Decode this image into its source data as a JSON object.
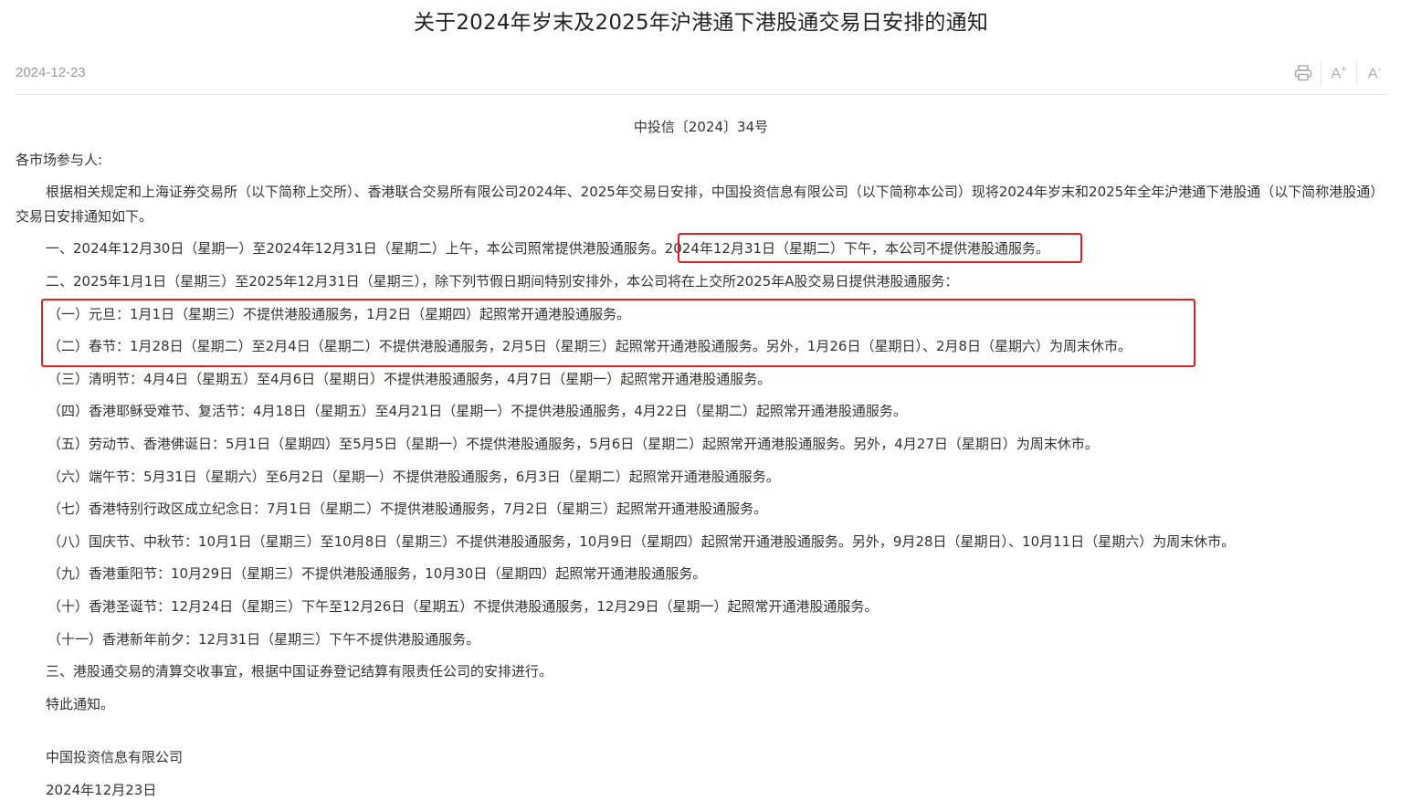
{
  "article": {
    "title": "关于2024年岁末及2025年沪港通下港股通交易日安排的通知",
    "publish_date": "2024-12-23"
  },
  "toolbar": {
    "print_icon": "print-icon",
    "font_increase_label": "A",
    "font_increase_sign": "+",
    "font_decrease_label": "A",
    "font_decrease_sign": "-"
  },
  "body": {
    "doc_number": "中投信〔2024〕34号",
    "salutation": "各市场参与人:",
    "intro": "根据相关规定和上海证券交易所（以下简称上交所）、香港联合交易所有限公司2024年、2025年交易日安排，中国投资信息有限公司（以下简称本公司）现将2024年岁末和2025年全年沪港通下港股通（以下简称港股通）交易日安排通知如下。",
    "item1_part1": "一、2024年12月30日（星期一）至2024年12月31日（星期二）上午，本公司照常提供港股通服务。",
    "item1_part2": "2024年12月31日（星期二）下午，本公司不提供港股通服务。",
    "item2": "二、2025年1月1日（星期三）至2025年12月31日（星期三），除下列节假日期间特别安排外，本公司将在上交所2025年A股交易日提供港股通服务：",
    "holidays": [
      "（一）元旦：1月1日（星期三）不提供港股通服务，1月2日（星期四）起照常开通港股通服务。",
      "（二）春节：1月28日（星期二）至2月4日（星期二）不提供港股通服务，2月5日（星期三）起照常开通港股通服务。另外，1月26日（星期日）、2月8日（星期六）为周末休市。",
      "（三）清明节：4月4日（星期五）至4月6日（星期日）不提供港股通服务，4月7日（星期一）起照常开通港股通服务。",
      "（四）香港耶稣受难节、复活节：4月18日（星期五）至4月21日（星期一）不提供港股通服务，4月22日（星期二）起照常开通港股通服务。",
      "（五）劳动节、香港佛诞日：5月1日（星期四）至5月5日（星期一）不提供港股通服务，5月6日（星期二）起照常开通港股通服务。另外，4月27日（星期日）为周末休市。",
      "（六）端午节：5月31日（星期六）至6月2日（星期一）不提供港股通服务，6月3日（星期二）起照常开通港股通服务。",
      "（七）香港特别行政区成立纪念日：7月1日（星期二）不提供港股通服务，7月2日（星期三）起照常开通港股通服务。",
      "（八）国庆节、中秋节：10月1日（星期三）至10月8日（星期三）不提供港股通服务，10月9日（星期四）起照常开通港股通服务。另外，9月28日（星期日）、10月11日（星期六）为周末休市。",
      "（九）香港重阳节：10月29日（星期三）不提供港股通服务，10月30日（星期四）起照常开通港股通服务。",
      "（十）香港圣诞节：12月24日（星期三）下午至12月26日（星期五）不提供港股通服务，12月29日（星期一）起照常开通港股通服务。",
      "（十一）香港新年前夕：12月31日（星期三）下午不提供港股通服务。"
    ],
    "item3": "三、港股通交易的清算交收事宜，根据中国证券登记结算有限责任公司的安排进行。",
    "closing": "特此通知。",
    "signature_org": "中国投资信息有限公司",
    "signature_date": "2024年12月23日"
  },
  "highlight_color": "#e02020"
}
